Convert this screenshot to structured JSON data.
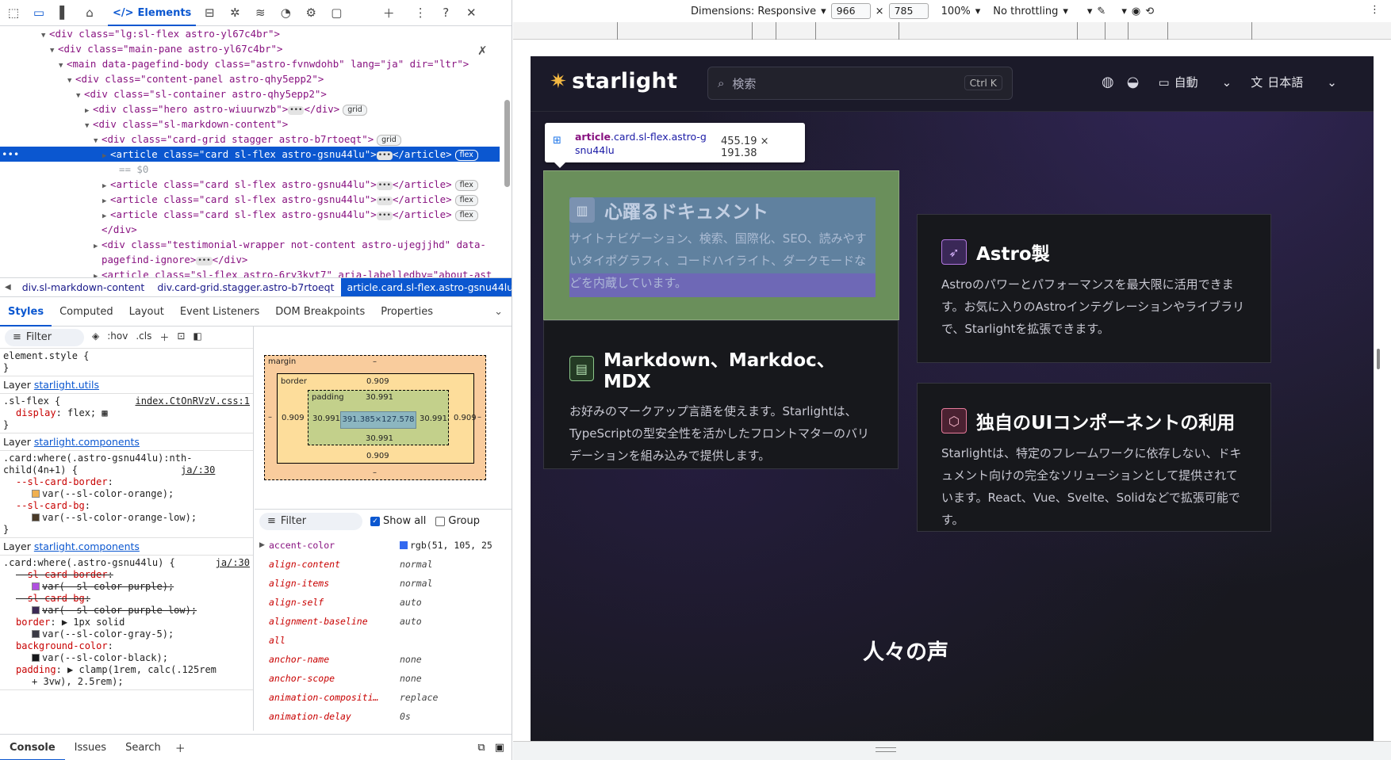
{
  "devtools": {
    "toolbar": {
      "elements_tab": "Elements",
      "elements_tag": "</>"
    },
    "dom_lines": [
      {
        "indent": 4,
        "tri": "▼",
        "html": "<div class=\"lg:sl-flex astro-yl67c4br\">"
      },
      {
        "indent": 5,
        "tri": "▼",
        "html": "<div class=\"main-pane astro-yl67c4br\">"
      },
      {
        "indent": 6,
        "tri": "▼",
        "html": "<main data-pagefind-body class=\"astro-fvnwdohb\" lang=\"ja\" dir=\"ltr\">"
      },
      {
        "indent": 7,
        "tri": "▼",
        "html": "<div class=\"content-panel astro-qhy5epp2\">"
      },
      {
        "indent": 8,
        "tri": "▼",
        "html": "<div class=\"sl-container astro-qhy5epp2\">"
      },
      {
        "indent": 9,
        "tri": "▶",
        "html": "<div class=\"hero astro-wiuurwzb\">",
        "tail": "</div>",
        "ell": true,
        "badge": "grid"
      },
      {
        "indent": 9,
        "tri": "▼",
        "html": "<div class=\"sl-markdown-content\">"
      },
      {
        "indent": 10,
        "tri": "▼",
        "html": "<div class=\"card-grid stagger astro-b7rtoeqt\">",
        "badge": "grid"
      },
      {
        "indent": 11,
        "tri": "▶",
        "html": "<article class=\"card sl-flex astro-gsnu44lu\">",
        "tail": "</article>",
        "ell": true,
        "badge": "flex",
        "selected": true
      },
      {
        "indent": 12,
        "tri": "",
        "html": "== $0",
        "ghost": true
      },
      {
        "indent": 11,
        "tri": "▶",
        "html": "<article class=\"card sl-flex astro-gsnu44lu\">",
        "tail": "</article>",
        "ell": true,
        "badge": "flex"
      },
      {
        "indent": 11,
        "tri": "▶",
        "html": "<article class=\"card sl-flex astro-gsnu44lu\">",
        "tail": "</article>",
        "ell": true,
        "badge": "flex"
      },
      {
        "indent": 11,
        "tri": "▶",
        "html": "<article class=\"card sl-flex astro-gsnu44lu\">",
        "tail": "</article>",
        "ell": true,
        "badge": "flex"
      },
      {
        "indent": 10,
        "tri": "",
        "html": "</div>"
      },
      {
        "indent": 10,
        "tri": "▶",
        "html": "<div class=\"testimonial-wrapper not-content astro-ujegjjhd\" data-"
      },
      {
        "indent": 10,
        "tri": "",
        "html": "pagefind-ignore>",
        "tail": "</div>",
        "ell": true
      },
      {
        "indent": 10,
        "tri": "▶",
        "html": "<article class=\"sl-flex astro-6ry3kvt7\" aria-labelledby=\"about-ast"
      }
    ],
    "breadcrumb": [
      "div.sl-markdown-content",
      "div.card-grid.stagger.astro-b7rtoeqt",
      "article.card.sl-flex.astro-gsnu44lu"
    ],
    "style_tabs": [
      "Styles",
      "Computed",
      "Layout",
      "Event Listeners",
      "DOM Breakpoints",
      "Properties"
    ],
    "filter_placeholder": "Filter",
    "hov": ":hov",
    "cls": ".cls",
    "rules": {
      "element_style": "element.style {",
      "close": "}",
      "layer_utils_prefix": "Layer ",
      "layer_utils": "starlight.utils",
      "slflex_sel": ".sl-flex {",
      "slflex_src": "index.CtOnRVzV.css:1",
      "display_prop": "display",
      "display_val": "flex;",
      "layer_comp": "starlight.components",
      "nth_sel": ".card:where(.astro-gsnu44lu):nth-child(4n+1) {",
      "nth_src": "ja/:30",
      "card_border_prop": "--sl-card-border",
      "card_border_val": "var(--sl-color-orange);",
      "card_bg_prop": "--sl-card-bg",
      "card_bg_val": "var(--sl-color-orange-low);",
      "card_sel": ".card:where(.astro-gsnu44lu) {",
      "card_src": "ja/:30",
      "purple_val": "var(--sl-color-purple);",
      "purple_low_val": "var(--sl-color-purple-low);",
      "border_prop": "border",
      "border_val": "1px solid",
      "gray5_val": "var(--sl-color-gray-5);",
      "bgc_prop": "background-color",
      "black_val": "var(--sl-color-black);",
      "padding_prop": "padding",
      "padding_val": "clamp(1rem, calc(.125rem",
      "padding_val2": "+ 3vw), 2.5rem);"
    },
    "boxmodel": {
      "margin_label": "margin",
      "margin_val": "–",
      "border_label": "border",
      "border_val": "0.909",
      "padding_label": "padding",
      "padding_val": "30.991",
      "content": "391.385×127.578"
    },
    "computed": {
      "filter": "Filter",
      "show_all": "Show all",
      "group": "Group",
      "rows": [
        {
          "n": "accent-color",
          "v": "rgb(51, 105, 25"
        },
        {
          "n": "align-content",
          "v": "normal"
        },
        {
          "n": "align-items",
          "v": "normal"
        },
        {
          "n": "align-self",
          "v": "auto"
        },
        {
          "n": "alignment-baseline",
          "v": "auto"
        },
        {
          "n": "all",
          "v": ""
        },
        {
          "n": "anchor-name",
          "v": "none"
        },
        {
          "n": "anchor-scope",
          "v": "none"
        },
        {
          "n": "animation-compositi…",
          "v": "replace"
        },
        {
          "n": "animation-delay",
          "v": "0s"
        }
      ]
    },
    "drawer_tabs": [
      "Console",
      "Issues",
      "Search"
    ]
  },
  "device_toolbar": {
    "dimensions_label": "Dimensions: Responsive",
    "width": "966",
    "x": "×",
    "height": "785",
    "zoom": "100%",
    "throttle": "No throttling"
  },
  "site": {
    "logo": "starlight",
    "search_placeholder": "検索",
    "search_kbd": "Ctrl K",
    "theme": "自動",
    "lang": "日本語",
    "tooltip_tag": "article",
    "tooltip_class": ".card.sl-flex.astro-gsnu44lu",
    "tooltip_size": "455.19 × 191.38",
    "cards": [
      {
        "title": "心躍るドキュメント",
        "body": "サイトナビゲーション、検索、国際化、SEO、読みやすいタイポグラフィ、コードハイライト、ダークモードなどを内蔵しています。",
        "icon": "book-icon",
        "color": "#f0a060"
      },
      {
        "title": "Astro製",
        "body": "Astroのパワーとパフォーマンスを最大限に活用できます。お気に入りのAstroインテグレーションやライブラリで、Starlightを拡張できます。",
        "icon": "rocket-icon",
        "color": "#b377e0"
      },
      {
        "title": "Markdown、Markdoc、MDX",
        "body": "お好みのマークアップ言語を使えます。Starlightは、TypeScriptの型安全性を活かしたフロントマターのバリデーションを組み込みで提供します。",
        "icon": "document-icon",
        "color": "#8cc78a"
      },
      {
        "title": "独自のUIコンポーネントの利用",
        "body": "Starlightは、特定のフレームワークに依存しない、ドキュメント向けの完全なソリューションとして提供されています。React、Vue、Svelte、Solidなどで拡張可能です。",
        "icon": "puzzle-icon",
        "color": "#e57a9a"
      }
    ],
    "section_heading": "人々の声"
  }
}
